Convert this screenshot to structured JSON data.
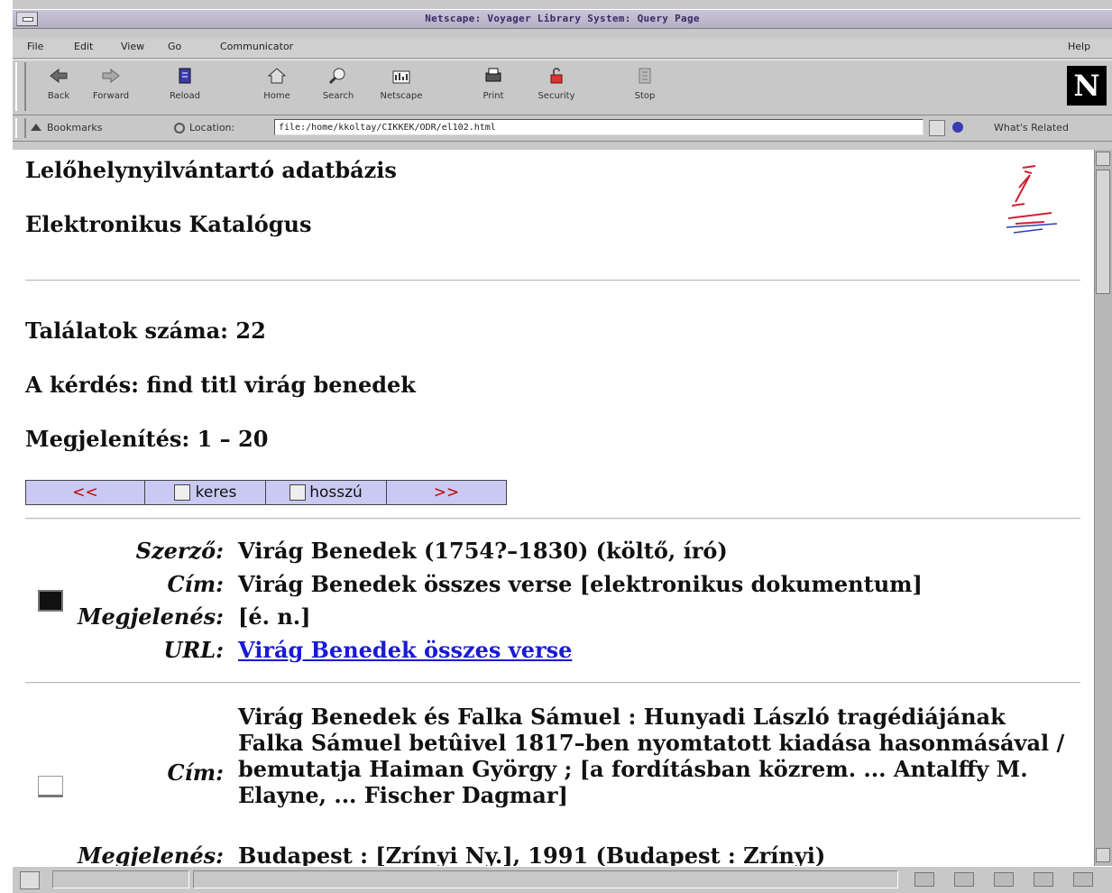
{
  "window": {
    "title": "Netscape: Voyager Library System: Query Page"
  },
  "menubar": {
    "items": [
      "File",
      "Edit",
      "View",
      "Go",
      "Communicator"
    ],
    "help": "Help"
  },
  "toolbar": {
    "buttons": [
      {
        "label": "Back",
        "icon": "back-arrow-icon"
      },
      {
        "label": "Forward",
        "icon": "forward-arrow-icon"
      },
      {
        "label": "Reload",
        "icon": "reload-icon"
      },
      {
        "label": "Home",
        "icon": "home-icon"
      },
      {
        "label": "Search",
        "icon": "search-icon"
      },
      {
        "label": "Netscape",
        "icon": "netscape-icon"
      },
      {
        "label": "Print",
        "icon": "print-icon"
      },
      {
        "label": "Security",
        "icon": "lock-icon"
      },
      {
        "label": "Stop",
        "icon": "stop-icon"
      }
    ],
    "logo": "N"
  },
  "locationbar": {
    "bookmarks_label": "Bookmarks",
    "location_label": "Location:",
    "url": "file:/home/kkoltay/CIKKEK/ODR/el102.html",
    "whats_related": "What's Related"
  },
  "page": {
    "heading1": "Lelőhelynyilvántartó adatbázis",
    "heading2": "Elektronikus Katalógus",
    "hits": "Találatok száma: 22",
    "query": "A kérdés: find titl virág benedek",
    "display": "Megjelenítés: 1 – 20",
    "nav": {
      "prev": "<<",
      "search": "keres",
      "long": "hosszú",
      "next": ">>"
    },
    "record1": {
      "author_label": "Szerző:",
      "author": "Virág Benedek (1754?–1830) (költő, író)",
      "title_label": "Cím:",
      "title": "Virág Benedek összes verse [elektronikus dokumentum]",
      "pub_label": "Megjelenés:",
      "pub": "[é. n.]",
      "url_label": "URL:",
      "url_text": "Virág Benedek összes verse "
    },
    "record2": {
      "title_label": "Cím:",
      "title": "Virág Benedek és Falka Sámuel : Hunyadi László tragédiájának Falka Sámuel betûivel 1817–ben nyomtatott kiadása hasonmásával / bemutatja Haiman György ; [a fordításban közrem. ... Antalffy M. Elayne, ... Fischer Dagmar]",
      "pub_label": "Megjelenés:",
      "pub": "Budapest : [Zrínyi Ny.], 1991 (Budapest : Zrínyi)"
    }
  },
  "colors": {
    "nav_bg": "#c9c9f4",
    "nav_arrow": "#c00000",
    "link": "#1a1ad6",
    "title_text": "#3a2a66"
  }
}
